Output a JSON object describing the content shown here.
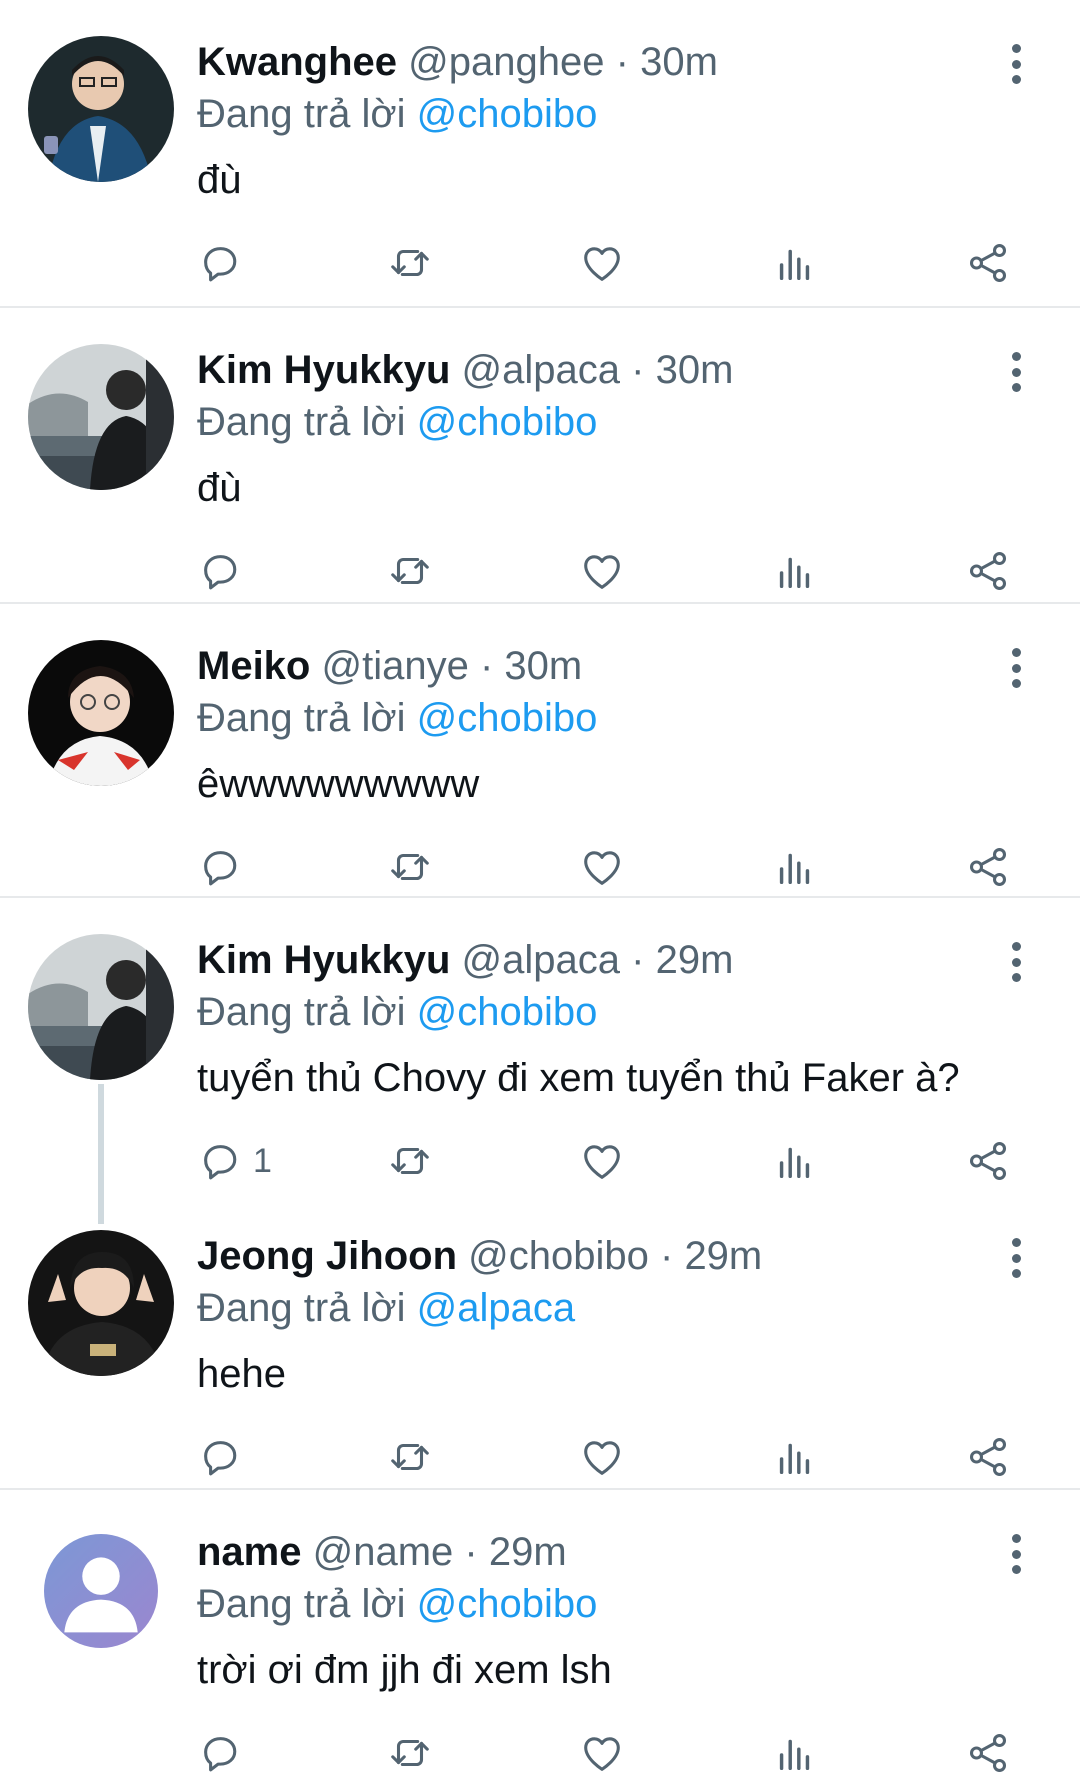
{
  "reply_prefix": "Đang trả lời",
  "separator": "·",
  "colors": {
    "mention": "#1d9bf0",
    "secondary": "#536471",
    "divider": "#e7e9eb"
  },
  "tweets": [
    {
      "name": "Kwanghee",
      "handle": "@panghee",
      "time": "30m",
      "reply_to": "@chobibo",
      "text": "đù",
      "reply_count": ""
    },
    {
      "name": "Kim Hyukkyu",
      "handle": "@alpaca",
      "time": "30m",
      "reply_to": "@chobibo",
      "text": "đù",
      "reply_count": ""
    },
    {
      "name": "Meiko",
      "handle": "@tianye",
      "time": "30m",
      "reply_to": "@chobibo",
      "text": "êwwwwwwwww",
      "reply_count": ""
    },
    {
      "name": "Kim Hyukkyu",
      "handle": "@alpaca",
      "time": "29m",
      "reply_to": "@chobibo",
      "text": "tuyển thủ Chovy đi xem tuyển thủ Faker à?",
      "reply_count": "1"
    },
    {
      "name": "Jeong Jihoon",
      "handle": "@chobibo",
      "time": "29m",
      "reply_to": "@alpaca",
      "text": "hehe",
      "reply_count": ""
    },
    {
      "name": "name",
      "handle": "@name",
      "time": "29m",
      "reply_to": "@chobibo",
      "text": "trời ơi đm jjh đi xem lsh",
      "reply_count": ""
    }
  ],
  "icons": {
    "reply": "reply-icon",
    "retweet": "retweet-icon",
    "like": "heart-icon",
    "views": "views-icon",
    "share": "share-icon",
    "more": "more-vertical-icon"
  }
}
